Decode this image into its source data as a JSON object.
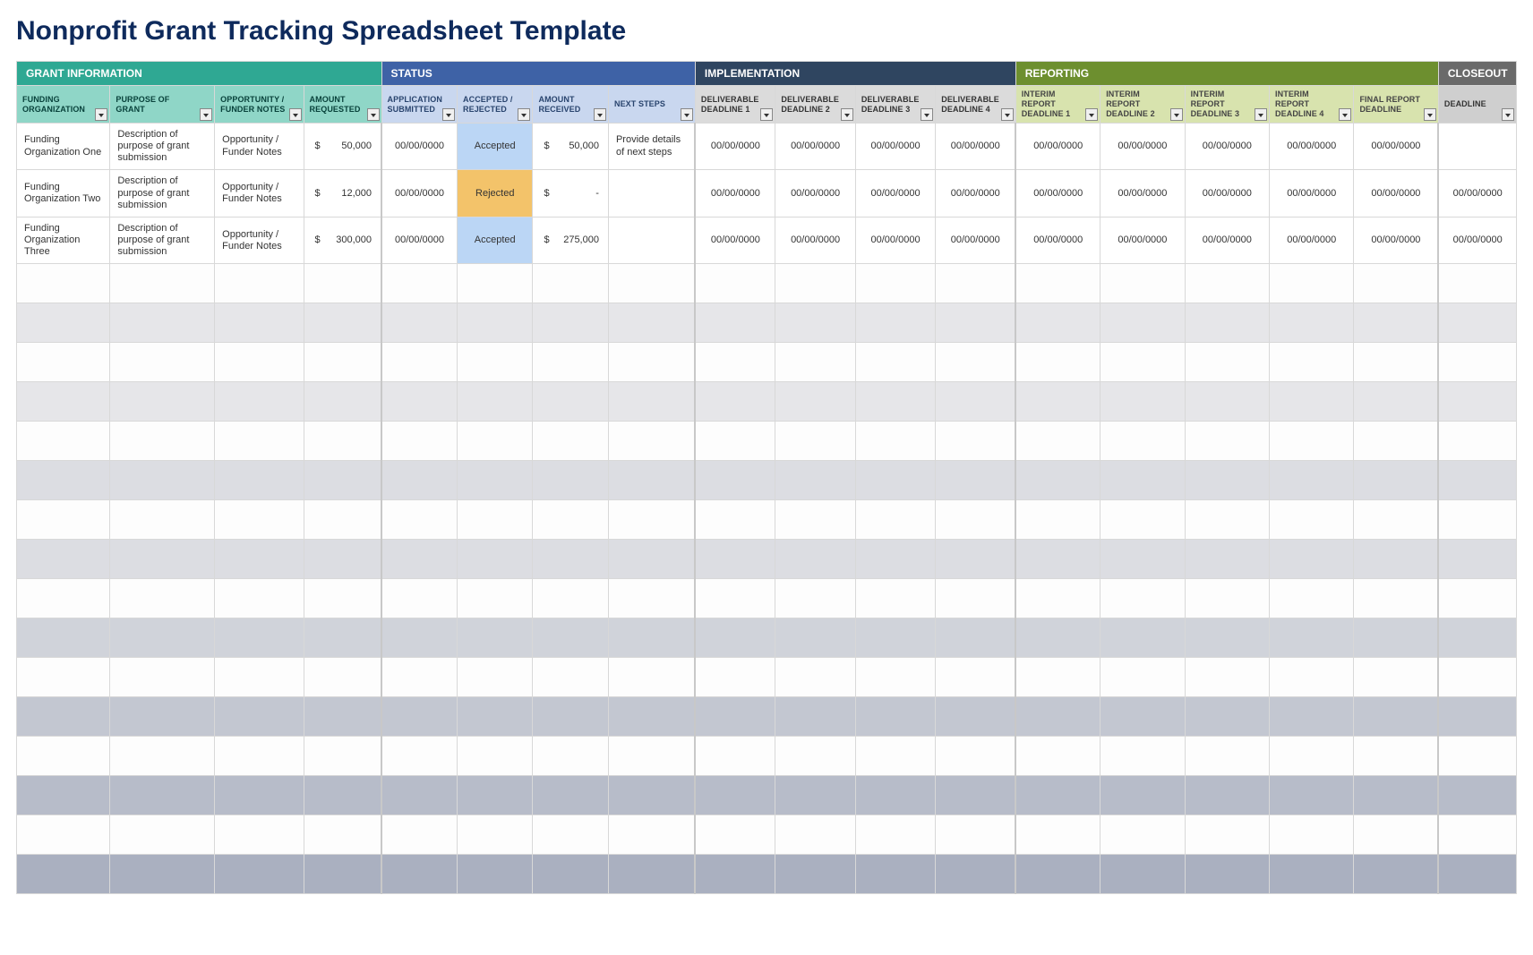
{
  "title": "Nonprofit Grant Tracking Spreadsheet Template",
  "sections": {
    "info": "GRANT INFORMATION",
    "status": "STATUS",
    "impl": "IMPLEMENTATION",
    "report": "REPORTING",
    "close": "CLOSEOUT"
  },
  "columns": {
    "funding_org": "FUNDING ORGANIZATION",
    "purpose": "PURPOSE OF GRANT",
    "opportunity": "OPPORTUNITY / FUNDER NOTES",
    "amount_req": "AMOUNT REQUESTED",
    "app_submitted": "APPLICATION SUBMITTED",
    "acc_rej": "ACCEPTED / REJECTED",
    "amount_recv": "AMOUNT RECEIVED",
    "next_steps": "NEXT STEPS",
    "deliv1": "DELIVERABLE DEADLINE 1",
    "deliv2": "DELIVERABLE DEADLINE 2",
    "deliv3": "DELIVERABLE DEADLINE 3",
    "deliv4": "DELIVERABLE DEADLINE 4",
    "interim1": "INTERIM REPORT DEADLINE 1",
    "interim2": "INTERIM REPORT DEADLINE 2",
    "interim3": "INTERIM REPORT DEADLINE 3",
    "interim4": "INTERIM REPORT DEADLINE 4",
    "final": "FINAL REPORT DEADLINE",
    "closedl": "DEADLINE"
  },
  "rows": [
    {
      "org": "Funding Organization One",
      "purpose": "Description of purpose of grant submission",
      "opportunity": "Opportunity / Funder Notes",
      "amount_req": "50,000",
      "app_submitted": "00/00/0000",
      "status": "Accepted",
      "status_class": "accepted",
      "amount_recv": "50,000",
      "next_steps": "Provide details of next steps",
      "dates": [
        "00/00/0000",
        "00/00/0000",
        "00/00/0000",
        "00/00/0000",
        "00/00/0000",
        "00/00/0000",
        "00/00/0000",
        "00/00/0000",
        "00/00/0000",
        ""
      ]
    },
    {
      "org": "Funding Organization Two",
      "purpose": "Description of purpose of grant submission",
      "opportunity": "Opportunity / Funder Notes",
      "amount_req": "12,000",
      "app_submitted": "00/00/0000",
      "status": "Rejected",
      "status_class": "rejected",
      "amount_recv": "-",
      "next_steps": "",
      "dates": [
        "00/00/0000",
        "00/00/0000",
        "00/00/0000",
        "00/00/0000",
        "00/00/0000",
        "00/00/0000",
        "00/00/0000",
        "00/00/0000",
        "00/00/0000",
        "00/00/0000"
      ]
    },
    {
      "org": "Funding Organization Three",
      "purpose": "Description of purpose of grant submission",
      "opportunity": "Opportunity / Funder Notes",
      "amount_req": "300,000",
      "app_submitted": "00/00/0000",
      "status": "Accepted",
      "status_class": "accepted",
      "amount_recv": "275,000",
      "next_steps": "",
      "dates": [
        "00/00/0000",
        "00/00/0000",
        "00/00/0000",
        "00/00/0000",
        "00/00/0000",
        "00/00/0000",
        "00/00/0000",
        "00/00/0000",
        "00/00/0000",
        "00/00/0000"
      ]
    }
  ],
  "currency": "$",
  "empty_rows": 16
}
